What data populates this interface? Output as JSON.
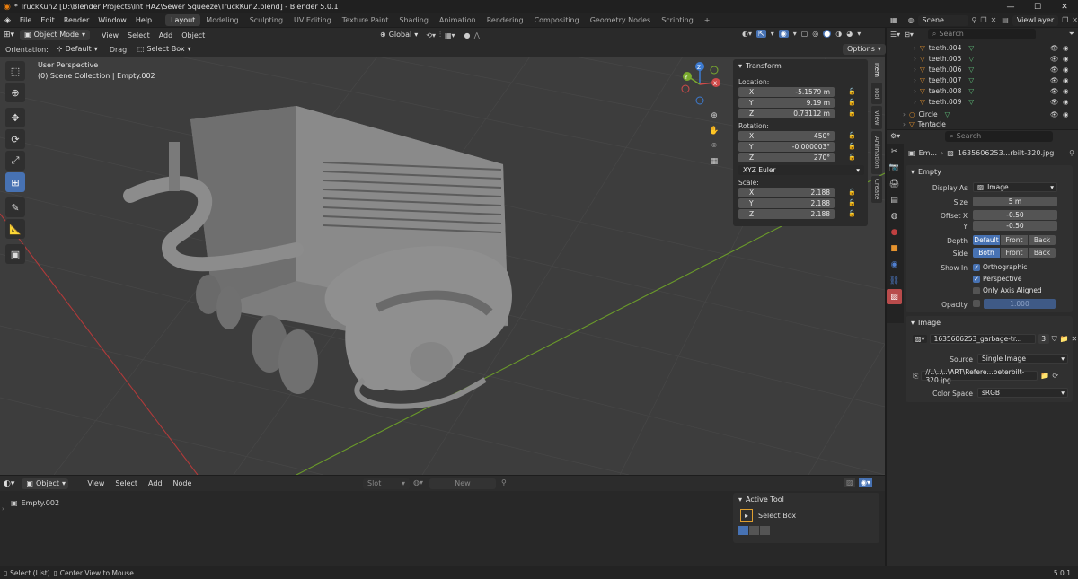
{
  "titlebar": {
    "title": "* TruckKun2 [D:\\Blender Projects\\Int HAZ\\Sewer Squeeze\\TruckKun2.blend] - Blender 5.0.1"
  },
  "menubar": {
    "menus": [
      "File",
      "Edit",
      "Render",
      "Window",
      "Help"
    ],
    "workspaces": [
      "Layout",
      "Modeling",
      "Sculpting",
      "UV Editing",
      "Texture Paint",
      "Shading",
      "Animation",
      "Rendering",
      "Compositing",
      "Geometry Nodes",
      "Scripting"
    ],
    "active_workspace": "Layout",
    "add_label": "+",
    "scene": "Scene",
    "view_layer": "ViewLayer"
  },
  "viewport_header": {
    "mode": "Object Mode",
    "menus": [
      "View",
      "Select",
      "Add",
      "Object"
    ],
    "transform_orientation": "Global",
    "options_label": "Options"
  },
  "viewport_subheader": {
    "orientation_label": "Orientation:",
    "orientation_value": "Default",
    "drag_label": "Drag:",
    "drag_value": "Select Box"
  },
  "viewport_overlay": {
    "perspective": "User Perspective",
    "collection": "(0) Scene Collection | Empty.002"
  },
  "gizmo": {
    "x": "X",
    "y": "Y",
    "z": "Z"
  },
  "n_panel": {
    "title": "Transform",
    "location_label": "Location:",
    "location": [
      {
        "axis": "X",
        "value": "-5.1579 m"
      },
      {
        "axis": "Y",
        "value": "9.19 m"
      },
      {
        "axis": "Z",
        "value": "0.73112 m"
      }
    ],
    "rotation_label": "Rotation:",
    "rotation": [
      {
        "axis": "X",
        "value": "450°"
      },
      {
        "axis": "Y",
        "value": "-0.000003°"
      },
      {
        "axis": "Z",
        "value": "270°"
      }
    ],
    "rotation_mode": "XYZ Euler",
    "scale_label": "Scale:",
    "scale": [
      {
        "axis": "X",
        "value": "2.188"
      },
      {
        "axis": "Y",
        "value": "2.188"
      },
      {
        "axis": "Z",
        "value": "2.188"
      }
    ],
    "tabs": [
      "Item",
      "Tool",
      "View",
      "Animation",
      "Create"
    ],
    "active_tab": "Item"
  },
  "bottom_editor": {
    "mode": "Object",
    "menus": [
      "View",
      "Select",
      "Add",
      "Node"
    ],
    "slot": "Slot",
    "new_label": "New",
    "item": "Empty.002"
  },
  "active_tool": {
    "title": "Active Tool",
    "tool": "Select Box"
  },
  "statusbar": {
    "left1": "Select (List)",
    "left2": "Center View to Mouse",
    "version": "5.0.1"
  },
  "outliner": {
    "search_placeholder": "Search",
    "rows": [
      "teeth.004",
      "teeth.005",
      "teeth.006",
      "teeth.007",
      "teeth.008",
      "teeth.009",
      "Circle",
      "Tentacle"
    ]
  },
  "properties": {
    "search_placeholder": "Search",
    "breadcrumb_object": "Em...",
    "breadcrumb_data": "1635606253...rbilt-320.jpg",
    "empty_section": "Empty",
    "display_as_label": "Display As",
    "display_as_value": "Image",
    "size_label": "Size",
    "size_value": "5 m",
    "offset_x_label": "Offset X",
    "offset_x_value": "-0.50",
    "offset_y_label": "Y",
    "offset_y_value": "-0.50",
    "depth_label": "Depth",
    "depth_options": [
      "Default",
      "Front",
      "Back"
    ],
    "depth_active": "Default",
    "side_label": "Side",
    "side_options": [
      "Both",
      "Front",
      "Back"
    ],
    "side_active": "Both",
    "show_in_label": "Show In",
    "show_orthographic": "Orthographic",
    "show_perspective": "Perspective",
    "only_axis_aligned": "Only Axis Aligned",
    "opacity_label": "Opacity",
    "opacity_value": "1.000",
    "image_section": "Image",
    "image_name": "1635606253_garbage-tr...",
    "image_users": "3",
    "source_label": "Source",
    "source_value": "Single Image",
    "filepath": "//..\\..\\..\\ART\\Refere...peterbilt-320.jpg",
    "color_space_label": "Color Space",
    "color_space_value": "sRGB"
  }
}
